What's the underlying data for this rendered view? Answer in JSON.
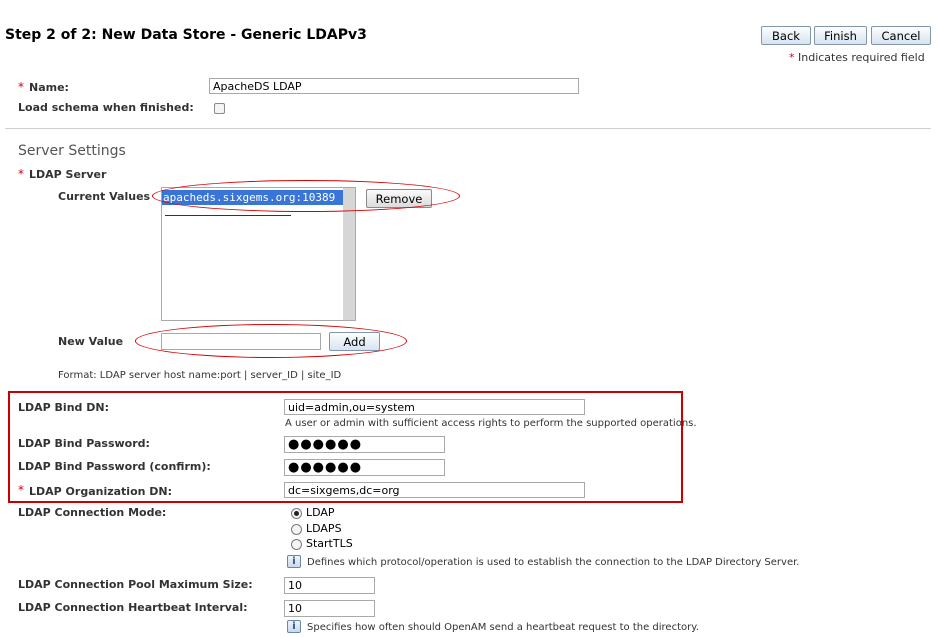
{
  "header": {
    "title": "Step 2 of 2: New Data Store - Generic LDAPv3",
    "back_label": "Back",
    "finish_label": "Finish",
    "cancel_label": "Cancel",
    "required_note": "Indicates required field",
    "asterisk": "*"
  },
  "fields": {
    "name_label": "Name:",
    "name_value": "ApacheDS LDAP",
    "load_schema_label": "Load schema when finished:",
    "load_schema_checked": false
  },
  "server_settings": {
    "section_title": "Server Settings",
    "ldap_server_label": "LDAP Server",
    "current_values_label": "Current Values",
    "current_values": [
      "apacheds.sixgems.org:10389"
    ],
    "remove_label": "Remove",
    "new_value_label": "New Value",
    "new_value": "",
    "add_label": "Add",
    "format_hint": "Format: LDAP server host name:port | server_ID | site_ID"
  },
  "bind": {
    "bind_dn_label": "LDAP Bind DN:",
    "bind_dn_value": "uid=admin,ou=system",
    "bind_dn_hint": "A user or admin with sufficient access rights to perform the supported operations.",
    "password_label": "LDAP Bind Password:",
    "password_mask": "●●●●●●",
    "password_confirm_label": "LDAP Bind Password (confirm):",
    "password_confirm_mask": "●●●●●●",
    "org_dn_label": "LDAP Organization DN:",
    "org_dn_value": "dc=sixgems,dc=org"
  },
  "connection": {
    "mode_label": "LDAP Connection Mode:",
    "modes": [
      "LDAP",
      "LDAPS",
      "StartTLS"
    ],
    "selected_mode": "LDAP",
    "mode_hint": "Defines which protocol/operation is used to establish the connection to the LDAP Directory Server.",
    "pool_label": "LDAP Connection Pool Maximum Size:",
    "pool_value": "10",
    "heartbeat_label": "LDAP Connection Heartbeat Interval:",
    "heartbeat_value": "10",
    "heartbeat_hint": "Specifies how often should OpenAM send a heartbeat request to the directory.",
    "info_icon_glyph": "i"
  },
  "colors": {
    "required_asterisk": "#d0021b",
    "annotation_red": "#d40000",
    "selection_blue": "#3875d7"
  }
}
